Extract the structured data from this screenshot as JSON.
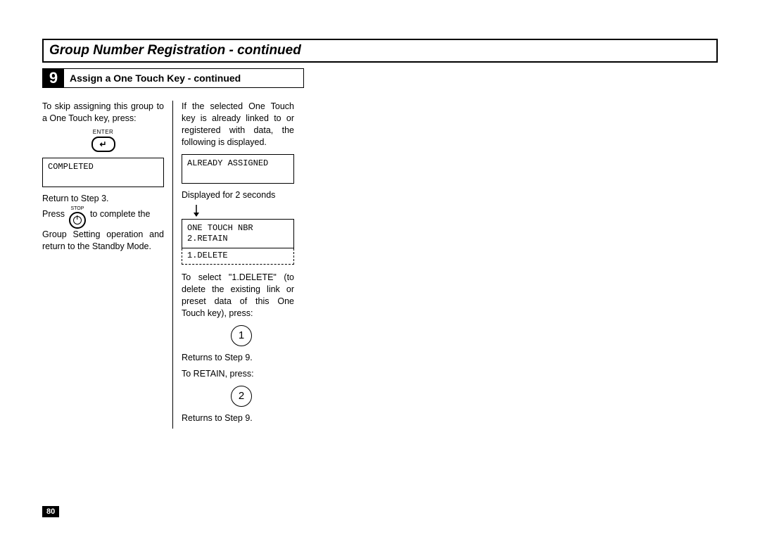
{
  "page_number": "80",
  "title": "Group Number Registration - continued",
  "step": {
    "number": "9",
    "title": "Assign a One Touch Key - continued"
  },
  "col1": {
    "p1": "To skip assigning this group to a One Touch key, press:",
    "enter_label": "ENTER",
    "enter_glyph": "↵",
    "lcd_completed": "COMPLETED",
    "p2": "Return to Step 3.",
    "press_word": "Press",
    "stop_label": "STOP",
    "p3_tail": "to complete the",
    "p3_rest": "Group Setting operation and return to the Standby Mode."
  },
  "col2": {
    "p1": "If the selected One Touch key is already linked to or registered with data, the following is displayed.",
    "lcd_already": "ALREADY ASSIGNED",
    "disp2s": "Displayed for 2 seconds",
    "lcd_one_touch_l1": "ONE TOUCH NBR",
    "lcd_one_touch_l2": "2.RETAIN",
    "lcd_dashed": "1.DELETE",
    "p2": "To select \"1.DELETE\" (to delete the existing link or preset data of this One Touch key), press:",
    "btn1": "1",
    "p3": "Returns to Step 9.",
    "p4": "To RETAIN, press:",
    "btn2": "2",
    "p5": "Returns to Step 9."
  }
}
